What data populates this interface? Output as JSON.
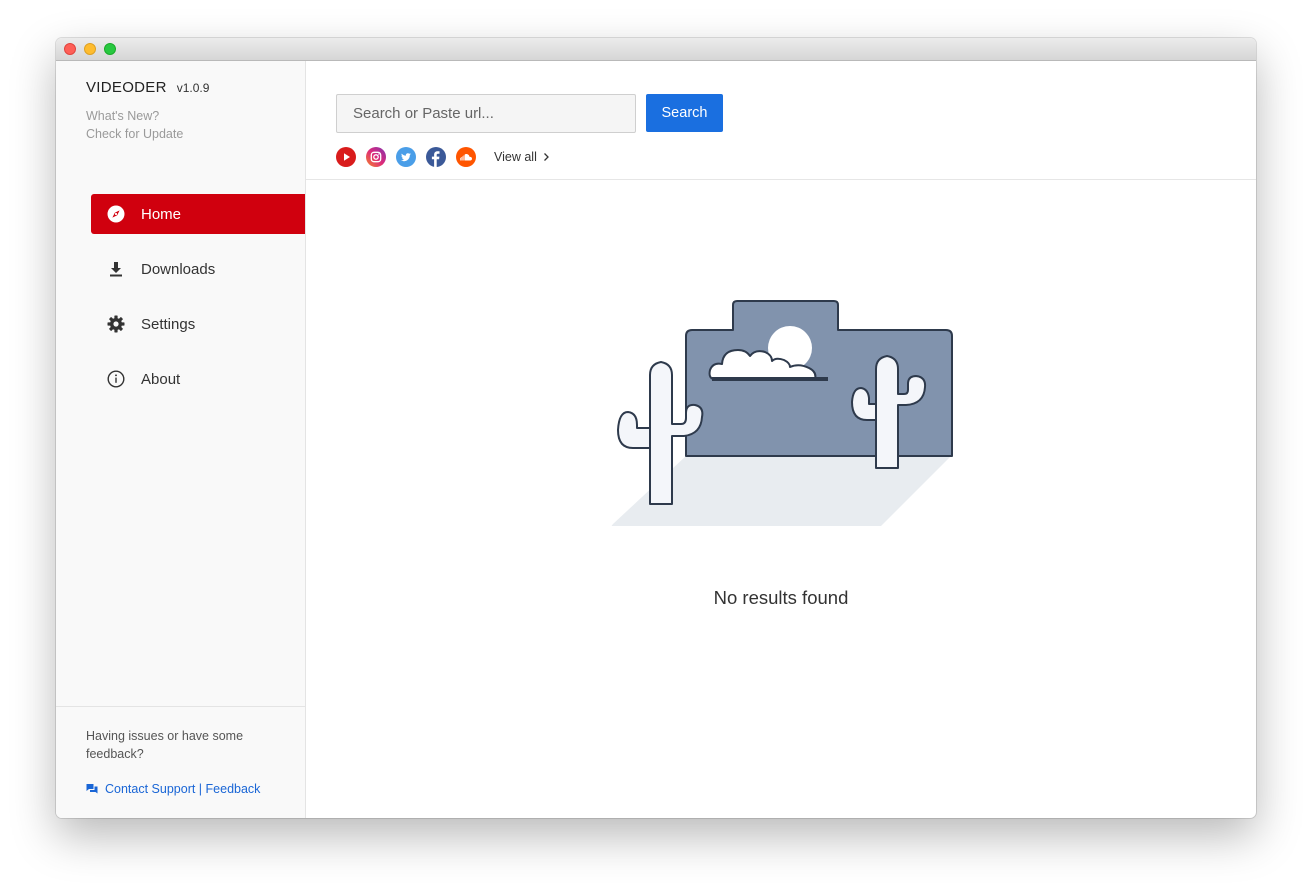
{
  "window": {
    "controls": [
      "close",
      "minimize",
      "maximize"
    ]
  },
  "sidebar": {
    "brand": "VIDEODER",
    "version": "v1.0.9",
    "links": [
      {
        "label": "What's New?"
      },
      {
        "label": "Check for Update"
      }
    ],
    "nav": [
      {
        "label": "Home",
        "icon": "compass-icon",
        "active": true
      },
      {
        "label": "Downloads",
        "icon": "download-icon",
        "active": false
      },
      {
        "label": "Settings",
        "icon": "gear-icon",
        "active": false
      },
      {
        "label": "About",
        "icon": "info-icon",
        "active": false
      }
    ],
    "footer": {
      "question": "Having issues or have some feedback?",
      "contact": "Contact Support | Feedback",
      "contact_icon": "chat-icon"
    }
  },
  "search": {
    "placeholder": "Search or Paste url...",
    "value": "",
    "button": "Search"
  },
  "services": [
    {
      "name": "youtube-icon",
      "color": "#e62117"
    },
    {
      "name": "instagram-icon",
      "color": "#d6249f"
    },
    {
      "name": "twitter-icon",
      "color": "#1da1f2"
    },
    {
      "name": "facebook-icon",
      "color": "#3b5998"
    },
    {
      "name": "soundcloud-icon",
      "color": "#ff5500"
    }
  ],
  "view_all": "View all",
  "empty_state": {
    "message": "No results found",
    "illustration": "desert-cactus-illustration"
  },
  "colors": {
    "accent_red": "#d0000e",
    "button_blue": "#1a6fe0",
    "link_blue": "#1a66d6"
  }
}
